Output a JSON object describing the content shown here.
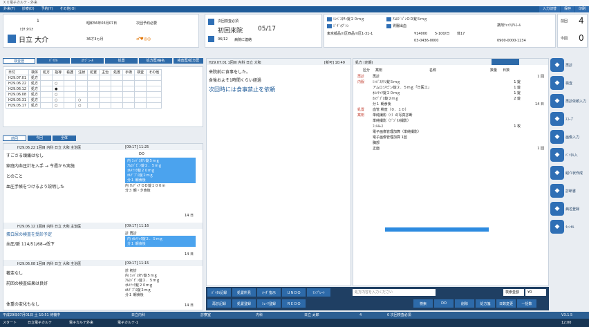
{
  "window": {
    "title": "ＸＸ電子カルテ - 外来"
  },
  "menu": {
    "items": [
      "外来(F)",
      "診療(D)",
      "予約(Y)",
      "その他(O)"
    ],
    "right": [
      "入力切替",
      "保存",
      "印刷"
    ]
  },
  "patient": {
    "id": "1",
    "kana": "ﾋﾀﾁ ﾀｲｽｹ",
    "name": "日立 大介",
    "birth": "昭和56年03月07日",
    "age": "36才3ヵ月",
    "reserve": "次回予約必要",
    "gender_icons": "♂♥◎◎"
  },
  "visit": {
    "title": "次回検査必須",
    "dept": "初回来院",
    "date": "05/17",
    "next": "06/12",
    "next_label": "病院に連絡"
  },
  "allergy": {
    "item1": "ｼﾝﾊﾞｽﾀﾁﾝ錠２０ｍｇ",
    "item2": "ｱﾑﾛｼﾞﾋﾟﾝＯＤ錠５ｍｇ",
    "item3": "ｼﾞｷﾞｵﾌﾟｼﾝ",
    "item4": "胃腸出血",
    "item5": "漢方薬剤",
    "addr": "東京都品川区西品川区1-31-1",
    "tel": "03-0436-0000",
    "extra": "0900-0000-1234",
    "code1": "¥14000",
    "code2": "5-100/日",
    "weight": "体17",
    "msg": "薬剤ﾁｪｯｸ/ｱﾙｺｰﾙ",
    "count_label1": "前回",
    "count_val1": "4",
    "count_label2": "今回",
    "count_val2": "0"
  },
  "left_tabs": [
    "検査歴",
    "ﾊﾞｲﾀﾙ",
    "ｽｹｼﾞｭｰﾙ",
    "処置",
    "処方歴/病名",
    "検査歴/処方歴"
  ],
  "history": {
    "headers": [
      "日付",
      "検体",
      "処方",
      "指導",
      "看護",
      "注射",
      "処置",
      "主治",
      "処置",
      "手術",
      "検査",
      "その他"
    ],
    "rows": [
      {
        "date": "H29.07.01",
        "type": "処方",
        "c2": "",
        "c3": ""
      },
      {
        "date": "H29.06.22",
        "type": "処方",
        "c2": "○",
        "c3": ""
      },
      {
        "date": "H29.06.12",
        "type": "処方",
        "c2": "●",
        "c3": ""
      },
      {
        "date": "H29.06.08",
        "type": "処方",
        "c2": "○",
        "c3": ""
      },
      {
        "date": "H29.05.31",
        "type": "処方",
        "c2": "○",
        "c3": "○"
      },
      {
        "date": "H29.05.17",
        "type": "処方",
        "c2": "○",
        "c3": "○"
      }
    ]
  },
  "lower_tabs": [
    "前回",
    "今回",
    "全体"
  ],
  "notes": [
    {
      "head": "H29.06.22 1回目 内科 日立 大和 主治医",
      "time": "[09:17] 11:25",
      "lines": [
        "すごさる頭痛はなし",
        "家庭内血圧計を入手 → 今週から実施",
        "とのこと",
        "血圧手帳をつけるよう説明した"
      ],
      "rx": [
        "DO",
        "内 ｼﾝﾊﾞｽﾀﾁﾝ錠５ｍｇ",
        "ｱﾑﾛｼﾞﾋﾟﾝ錠２．５ｍｇ",
        "ｵﾙﾒﾃｯｸ錠２０ｍｇ",
        "ｶﾙﾃﾞﾌﾟﾛ錠２ｍｇ",
        "分１ 朝食後",
        "内 ｱﾚﾃﾞｨｱ ＯＤ錠１００ｍ",
        "分３ 朝・夕食後"
      ],
      "days": "14 日"
    },
    {
      "head": "H29.06.12 1回目 内科 日立 大和 主治医",
      "time": "[09:17] 11:16",
      "lines": [
        "蛋白尿の検査を受診予定",
        "血圧/脈 114/51/68→低下"
      ],
      "rx": [
        "診 再診",
        "内 ｵﾙﾒﾃｯｸ錠２．５ｍｇ",
        "分１ 朝食後"
      ],
      "days": "14 日"
    },
    {
      "head": "H29.06.08 1回目 内科 日立 大和 主治医",
      "time": "[09:17] 11:15",
      "lines": [
        "著変なし",
        "前回の検査結果は良好",
        "",
        "体重の変化もなし"
      ],
      "rx": [
        "診 初診",
        "内 ｼﾝﾊﾞｽﾀﾁﾝ錠５ｍｇ",
        "ｱﾑﾛｼﾞﾋﾟﾝ錠２．５ｍｇ",
        "ｵﾙﾒﾃｯｸ錠２０ｍｇ",
        "ｶﾙﾃﾞﾌﾟﾛ錠２ｍｇ",
        "分１ 朝食後"
      ],
      "days": "14 日"
    }
  ],
  "center": {
    "head": "H29.07.01 1回目 内科 日立 大和",
    "time": "[新可] 10:49",
    "text1": "来院前に食事をした。",
    "text2": "食後およそ1時間くらい経過",
    "text3": "次回時には食事禁止を依頼"
  },
  "order": {
    "title": "処方 (定期)",
    "cols": [
      "区分",
      "薬剤",
      "名称",
      "数量",
      "日数"
    ],
    "rows": [
      {
        "c": "再診",
        "n": "再診",
        "q": "",
        "d": "1 回"
      },
      {
        "c": "内服",
        "n": "ｼﾝﾊﾞｽﾀﾁﾝ錠５ｍｇ",
        "q": "1 錠",
        "d": ""
      },
      {
        "c": "",
        "n": "アムロジピン錠２．５ｍｇ「日医工」",
        "q": "1 錠",
        "d": ""
      },
      {
        "c": "",
        "n": "ｵﾙﾒﾃｯｸ錠２０ｍｇ",
        "q": "1 錠",
        "d": ""
      },
      {
        "c": "",
        "n": "ｶﾙﾃﾞﾌﾟﾛ錠２ｍｇ",
        "q": "2 錠",
        "d": ""
      },
      {
        "c": "",
        "n": "分１ 朝食後",
        "q": "",
        "d": "14 日"
      },
      {
        "c": "処置",
        "n": "血管 検査（０．１０）",
        "q": "",
        "d": ""
      },
      {
        "c": "薬剤",
        "n": "単純撮影（ｲ）の写真診断",
        "q": "",
        "d": ""
      },
      {
        "c": "",
        "n": "単純撮影（ﾃﾞｼﾞﾀﾙ撮影）",
        "q": "",
        "d": ""
      },
      {
        "c": "",
        "n": "ﾌｨﾙﾑﾚｽ",
        "q": "1 枚",
        "d": ""
      },
      {
        "c": "",
        "n": "電子画像管理加算（単純撮影）",
        "q": "",
        "d": ""
      },
      {
        "c": "",
        "n": "電子画像管理加算 1回",
        "q": "",
        "d": ""
      },
      {
        "c": "",
        "n": "胸部",
        "q": "",
        "d": ""
      },
      {
        "c": "",
        "n": "正面",
        "q": "",
        "d": "1 回"
      }
    ]
  },
  "bottom_bar": {
    "row1": [
      "ﾊﾞｲﾀﾙ記録",
      "処置所見",
      "ｵｰﾀﾞ指示",
      "ＵＮＤＯ",
      "ﾃﾝﾌﾟﾚｰﾄ"
    ],
    "row2": [
      "再診記録",
      "処置登録",
      "ｼｪｰﾏ登録",
      "ＲＥＤＯ"
    ],
    "input_placeholder": "処方内容を入力ください",
    "right1": [
      "検索金額",
      "¥0"
    ],
    "right2": [
      "検索",
      "DO",
      "削除",
      "処方箋",
      "日数変更",
      "一括数"
    ]
  },
  "right_buttons": [
    "再診",
    "検査",
    "再診依頼入力",
    "ｽｺｰﾌﾟ",
    "画像入力",
    "ﾊﾞｲﾀﾙ入",
    "紹介状作成",
    "診断書",
    "病名登録",
    "ｷｬﾝｾﾙ"
  ],
  "status": {
    "date": "平成29年07月01日 土 10:51 待機中",
    "mode": "日立内科",
    "state": "診察室",
    "dept": "内科",
    "doc": "日立 太郎",
    "num": "4",
    "next": "0 次回検査必須",
    "version": "V3.1.5"
  },
  "taskbar": {
    "items": [
      "スタート",
      "日立電子カルテ",
      "電子カルテ外来",
      "電子カルテ-1"
    ],
    "clock": "12:00"
  }
}
